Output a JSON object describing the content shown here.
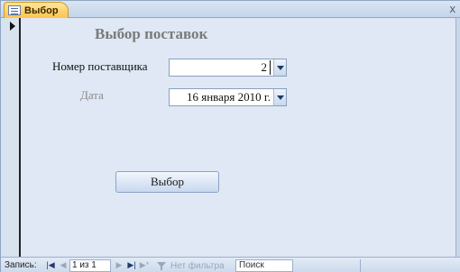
{
  "tab": {
    "title": "Выбор",
    "icon": "form-icon"
  },
  "window": {
    "close_icon": "close-icon",
    "close_glyph": "x"
  },
  "form": {
    "title": "Выбор поставок",
    "fields": [
      {
        "label": "Номер поставщика",
        "value": "2"
      },
      {
        "label": "Дата",
        "value": "16 января 2010 г."
      }
    ],
    "button_label": "Выбор"
  },
  "navbar": {
    "record_label": "Запись:",
    "position": "1 из 1",
    "filter_label": "Нет фильтра",
    "search_label": "Поиск",
    "first_glyph": "|◀",
    "prev_glyph": "◀",
    "next_glyph": "▶",
    "last_glyph": "▶|",
    "new_glyph": "▶*"
  },
  "colors": {
    "tab_active": "#ffc44a",
    "form_background": "#dfe8f4",
    "frame": "#b3c5db",
    "title_text": "#7a7a7a",
    "disabled_label": "#8a8a8a"
  }
}
